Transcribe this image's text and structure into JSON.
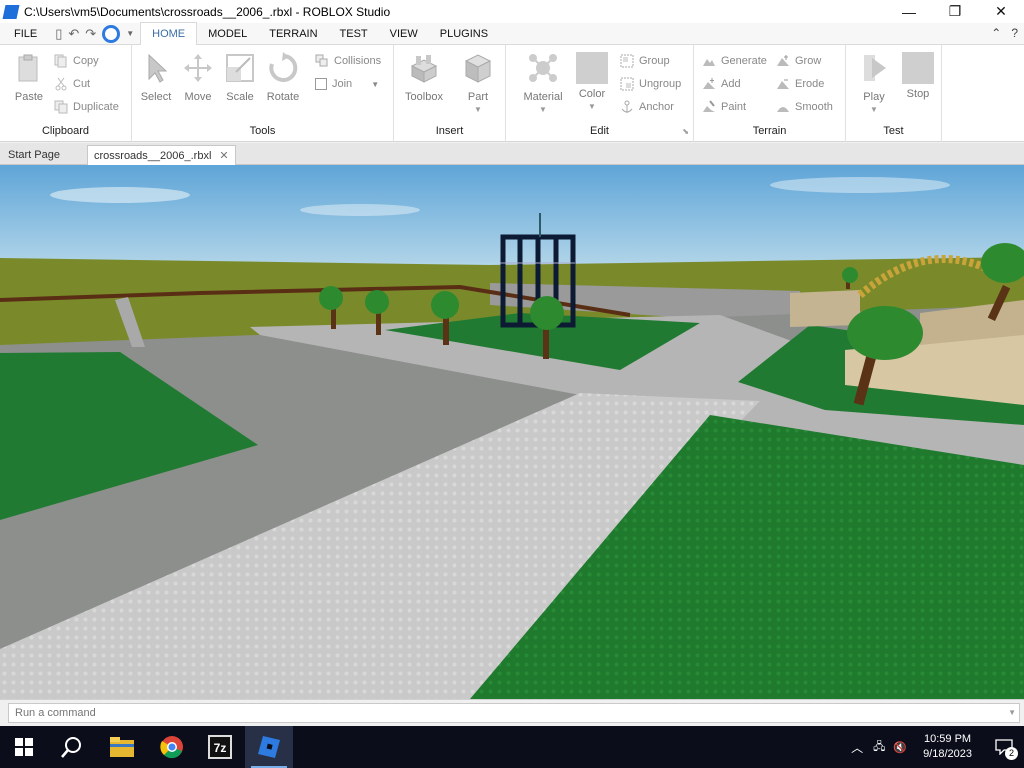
{
  "window": {
    "title": "C:\\Users\\vm5\\Documents\\crossroads__2006_.rbxl - ROBLOX Studio",
    "minimize": "—",
    "maximize": "❐",
    "close": "✕"
  },
  "ribbon_tabs": {
    "file": "FILE",
    "tabs": [
      "HOME",
      "MODEL",
      "TERRAIN",
      "TEST",
      "VIEW",
      "PLUGINS"
    ],
    "active": "HOME"
  },
  "clipboard": {
    "label": "Clipboard",
    "paste": "Paste",
    "copy": "Copy",
    "cut": "Cut",
    "duplicate": "Duplicate"
  },
  "tools": {
    "label": "Tools",
    "select": "Select",
    "move": "Move",
    "scale": "Scale",
    "rotate": "Rotate",
    "collisions": "Collisions",
    "join": "Join"
  },
  "insert": {
    "label": "Insert",
    "toolbox": "Toolbox",
    "part": "Part"
  },
  "edit": {
    "label": "Edit",
    "material": "Material",
    "color": "Color",
    "group": "Group",
    "ungroup": "Ungroup",
    "anchor": "Anchor"
  },
  "terrain": {
    "label": "Terrain",
    "generate": "Generate",
    "grow": "Grow",
    "add": "Add",
    "erode": "Erode",
    "paint": "Paint",
    "smooth": "Smooth"
  },
  "test": {
    "label": "Test",
    "play": "Play",
    "stop": "Stop"
  },
  "doc_tabs": [
    "Start Page",
    "crossroads__2006_.rbxl"
  ],
  "command_bar": {
    "placeholder": "Run a command"
  },
  "taskbar": {
    "time": "10:59 PM",
    "date": "9/18/2023",
    "notifications": "2"
  }
}
